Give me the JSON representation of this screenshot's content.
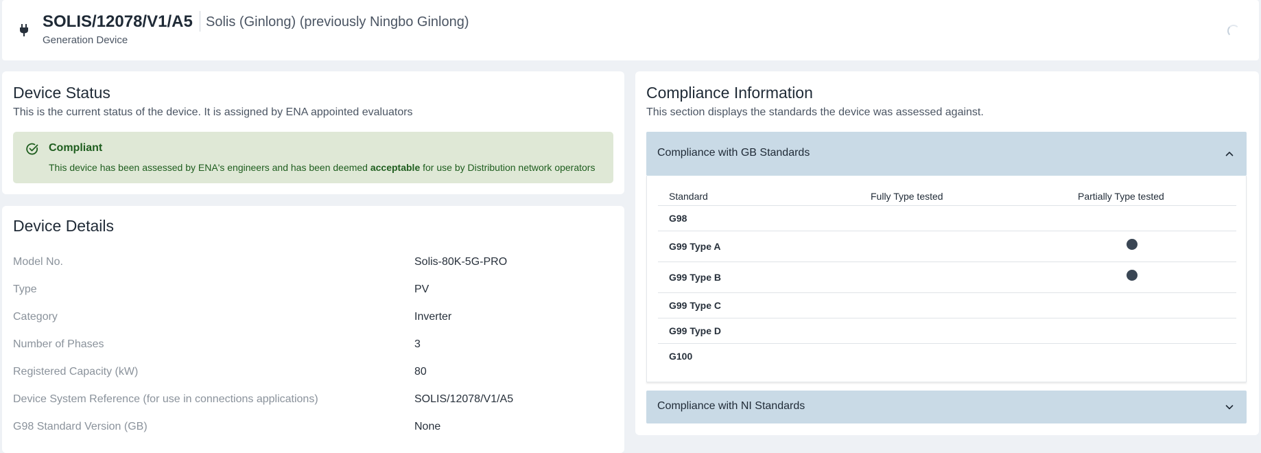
{
  "header": {
    "device_id": "SOLIS/12078/V1/A5",
    "manufacturer": "Solis (Ginlong) (previously Ningbo Ginlong)",
    "device_type": "Generation Device",
    "icon": "plug-icon"
  },
  "status_card": {
    "title": "Device Status",
    "description": "This is the current status of the device. It is assigned by ENA appointed evaluators",
    "status": {
      "label": "Compliant",
      "icon": "check-circle-icon",
      "text_before": "This device has been assessed by ENA's engineers and has been deemed ",
      "text_bold": "acceptable",
      "text_after": " for use by Distribution network operators",
      "color": "#1e5d1e",
      "background": "#dfe8d6"
    }
  },
  "details_card": {
    "title": "Device Details",
    "rows": [
      {
        "label": "Model No.",
        "value": "Solis-80K-5G-PRO"
      },
      {
        "label": "Type",
        "value": "PV"
      },
      {
        "label": "Category",
        "value": "Inverter"
      },
      {
        "label": "Number of Phases",
        "value": "3"
      },
      {
        "label": "Registered Capacity (kW)",
        "value": "80"
      },
      {
        "label": "Device System Reference (for use in connections applications)",
        "value": "SOLIS/12078/V1/A5"
      },
      {
        "label": "G98 Standard Version (GB)",
        "value": "None"
      }
    ]
  },
  "compliance_card": {
    "title": "Compliance Information",
    "description": "This section displays the standards the device was assessed against.",
    "gb": {
      "title": "Compliance with GB Standards",
      "expanded": true,
      "columns": [
        "Standard",
        "Fully Type tested",
        "Partially Type tested"
      ],
      "rows": [
        {
          "standard": "G98",
          "fully": false,
          "partially": false
        },
        {
          "standard": "G99 Type A",
          "fully": false,
          "partially": true
        },
        {
          "standard": "G99 Type B",
          "fully": false,
          "partially": true
        },
        {
          "standard": "G99 Type C",
          "fully": false,
          "partially": false
        },
        {
          "standard": "G99 Type D",
          "fully": false,
          "partially": false
        },
        {
          "standard": "G100",
          "fully": false,
          "partially": false
        }
      ]
    },
    "ni": {
      "title": "Compliance with NI Standards",
      "expanded": false
    },
    "header_color": "#c9dae6"
  }
}
